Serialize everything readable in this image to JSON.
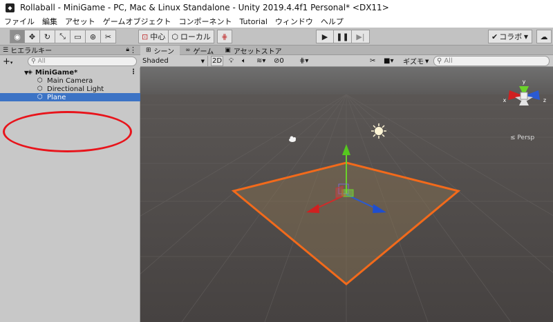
{
  "window": {
    "title": "Rollaball - MiniGame - PC, Mac & Linux Standalone - Unity 2019.4.4f1 Personal* <DX11>",
    "app_icon": "unity-logo-icon"
  },
  "menu": [
    "ファイル",
    "編集",
    "アセット",
    "ゲームオブジェクト",
    "コンポーネント",
    "Tutorial",
    "ウィンドウ",
    "ヘルプ"
  ],
  "toolbar": {
    "pivot_label": "中心",
    "space_label": "ローカル",
    "collab_label": "コラボ",
    "play_icon": "play-icon",
    "pause_icon": "pause-icon",
    "step_icon": "step-icon",
    "cloud_icon": "cloud-icon"
  },
  "hierarchy": {
    "tab_label": "ヒエラルキー",
    "search_placeholder": "All",
    "scene_name": "MiniGame*",
    "objects": [
      {
        "label": "Main Camera",
        "selected": false
      },
      {
        "label": "Directional Light",
        "selected": false
      },
      {
        "label": "Plane",
        "selected": true
      }
    ]
  },
  "scene_view": {
    "tabs": [
      {
        "label": "シーン",
        "icon": "grid-icon",
        "active": true
      },
      {
        "label": "ゲーム",
        "icon": "game-icon",
        "active": false
      },
      {
        "label": "アセットストア",
        "icon": "store-icon",
        "active": false
      }
    ],
    "shading_mode": "Shaded",
    "mode_2d": "2D",
    "hidden_count": "0",
    "gizmos_label": "ギズモ",
    "search_placeholder": "All",
    "projection_label": "Persp",
    "gizmo_y_label": "y",
    "gizmo_x_label": "x",
    "gizmo_z_label": "z"
  },
  "colors": {
    "selection": "#3c73c5",
    "selection_outline": "#f26a1b",
    "annotation_ring": "#e8141b",
    "viewport_bg": "#4a4645"
  }
}
